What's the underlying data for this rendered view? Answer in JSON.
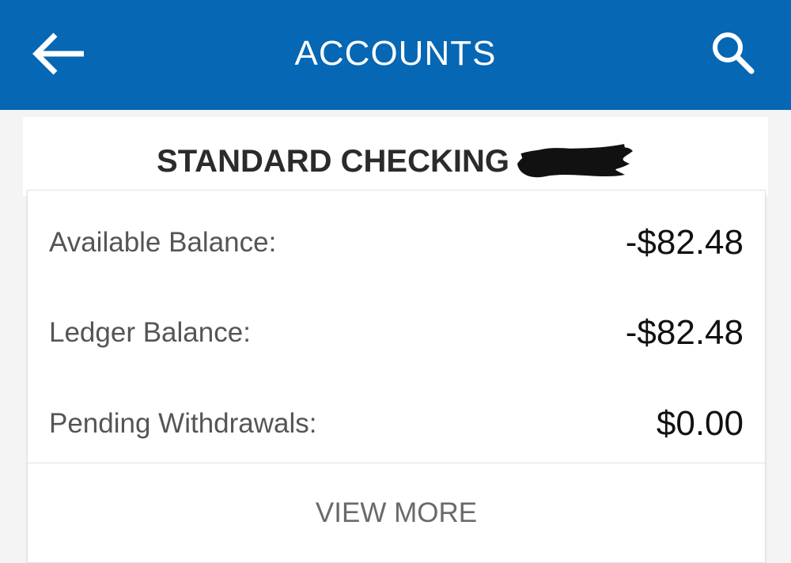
{
  "header": {
    "title": "ACCOUNTS",
    "back_icon": "arrow-left-icon",
    "search_icon": "search-icon",
    "bar_color": "#0667b4"
  },
  "account": {
    "name": "STANDARD CHECKING"
  },
  "balances": [
    {
      "label": "Available Balance:",
      "value": "-$82.48"
    },
    {
      "label": "Ledger Balance:",
      "value": "-$82.48"
    },
    {
      "label": "Pending Withdrawals:",
      "value": "$0.00"
    }
  ],
  "actions": {
    "view_more": "VIEW MORE"
  }
}
